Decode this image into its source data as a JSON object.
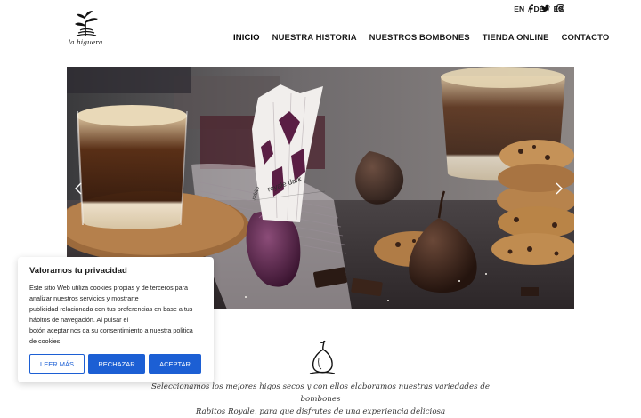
{
  "brand": {
    "name": "la higuera"
  },
  "languages": [
    {
      "code": "EN"
    },
    {
      "code": "DE"
    },
    {
      "code": "ES"
    }
  ],
  "language_separator": "/",
  "social": [
    "facebook-icon",
    "twitter-icon",
    "instagram-icon"
  ],
  "nav": {
    "items": [
      {
        "label": "INICIO",
        "active": true
      },
      {
        "label": "NUESTRA HISTORIA",
        "active": false
      },
      {
        "label": "NUESTROS BOMBONES",
        "active": false
      },
      {
        "label": "TIENDA ONLINE",
        "active": false
      },
      {
        "label": "CONTACTO",
        "active": false
      }
    ]
  },
  "hero": {
    "wrapper_text_1": "royale dark",
    "wrapper_text_2": "rabito"
  },
  "intro": {
    "line1": "Seleccionamos los mejores higos secos y con ellos elaboramos nuestras variedades de bombones",
    "line2": "Rabitos Royale, para que disfrutes de una experiencia deliciosa"
  },
  "cookie": {
    "title": "Valoramos tu privacidad",
    "lines": [
      "Este sitio Web utiliza cookies propias y de terceros para",
      "analizar nuestros servicios y mostrarte",
      "publicidad relacionada con tus preferencias en base a tus",
      "hábitos de navegación. Al pulsar el",
      "botón aceptar nos da su consentimiento a nuestra politica",
      "de cookies."
    ],
    "buttons": {
      "read_more": "LEER MÁS",
      "reject": "RECHAZAR",
      "accept": "ACEPTAR"
    }
  },
  "colors": {
    "accent_blue": "#1c5fd4",
    "text": "#1a1a1a"
  }
}
